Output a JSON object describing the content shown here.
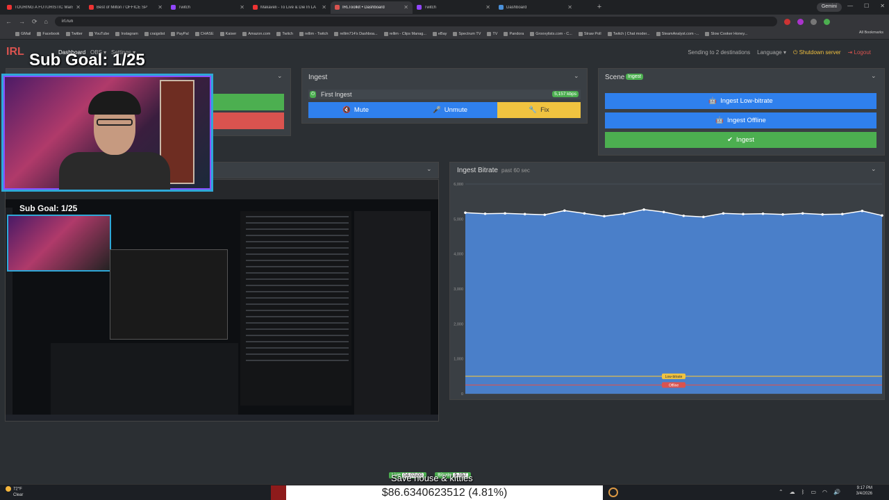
{
  "browser": {
    "tabs": [
      {
        "label": "TOURING A FUTURISTIC Mansi",
        "color": "#e33"
      },
      {
        "label": "Best of Milton / OFFICE SP",
        "color": "#e33"
      },
      {
        "label": "Twitch",
        "color": "#9146ff"
      },
      {
        "label": "Makaveli - To Live & Die In LA",
        "color": "#e33"
      },
      {
        "label": "IRLToolkit • Dashboard",
        "color": "#d9534f",
        "active": true
      },
      {
        "label": "Twitch",
        "color": "#9146ff"
      },
      {
        "label": "Dashboard",
        "color": "#4a90d9"
      }
    ],
    "url": "irl.run",
    "gemini_label": "Gemini",
    "bookmarks": [
      "GMail",
      "Facebook",
      "Twitter",
      "YouTube",
      "Instagram",
      "craigslist",
      "PayPal",
      "CHASE",
      "Kaiser",
      "Amazon.com",
      "Twitch",
      "rellim - Twitch",
      "rellim714's Dashboa...",
      "rellim - Clips Manag...",
      "eBay",
      "Spectrum TV",
      "TV",
      "Pandora",
      "Groovylists.com - C...",
      "Straw Poll",
      "Twitch | Chat moder...",
      "SteamAnalyst.com -...",
      "Slow Cooker Honey..."
    ],
    "all_bookmarks": "All Bookmarks"
  },
  "nav": {
    "dashboard": "Dashboard",
    "obs": "OBS ▾",
    "settings": "Settings ▾",
    "sending": "Sending to 2 destinations",
    "language": "Language ▾",
    "shutdown": "Shutdown server",
    "logout": "Logout"
  },
  "overlay": {
    "sub_goal": "Sub Goal: 1/25",
    "nested_sub_goal": "Sub Goal: 1/25",
    "save_house": "Save house & kitties",
    "live_label": "Live",
    "live_time": "04:02:00",
    "bitrate_label": "Bitrate",
    "bitrate_value": "5,157"
  },
  "ingest": {
    "title": "Ingest",
    "source": "First Ingest",
    "bitrate": "5,157",
    "bitrate_unit": "kbps",
    "mute": "Mute",
    "unmute": "Unmute",
    "fix": "Fix"
  },
  "scene": {
    "title": "Scene",
    "badge": "Ingest",
    "buttons": [
      "Ingest Low-bitrate",
      "Ingest Offline",
      "Ingest"
    ]
  },
  "chart_title": "Ingest Bitrate",
  "chart_subtitle": "past 60 sec",
  "chart_data": {
    "type": "area",
    "title": "Ingest Bitrate",
    "subtitle": "past 60 sec",
    "ylim": [
      0,
      6000
    ],
    "y_ticks": [
      "0",
      "1,000",
      "2,000",
      "3,000",
      "4,000",
      "5,000",
      "6,000"
    ],
    "series": [
      {
        "values": [
          5180,
          5150,
          5160,
          5140,
          5120,
          5240,
          5160,
          5080,
          5150,
          5270,
          5200,
          5090,
          5060,
          5160,
          5140,
          5150,
          5130,
          5160,
          5130,
          5140,
          5230,
          5100
        ]
      }
    ],
    "thresholds": [
      {
        "label": "Low-bitrate",
        "value": 500,
        "color": "#f0c340"
      },
      {
        "label": "Offline",
        "value": 250,
        "color": "#d9534f"
      }
    ],
    "fill_color": "#4a7fc9"
  },
  "taskbar": {
    "temp": "72°F",
    "condition": "Clear",
    "ticker": "$86.6340623512 (4.81%)",
    "time": "9:17 PM",
    "date": "3/4/2026"
  }
}
